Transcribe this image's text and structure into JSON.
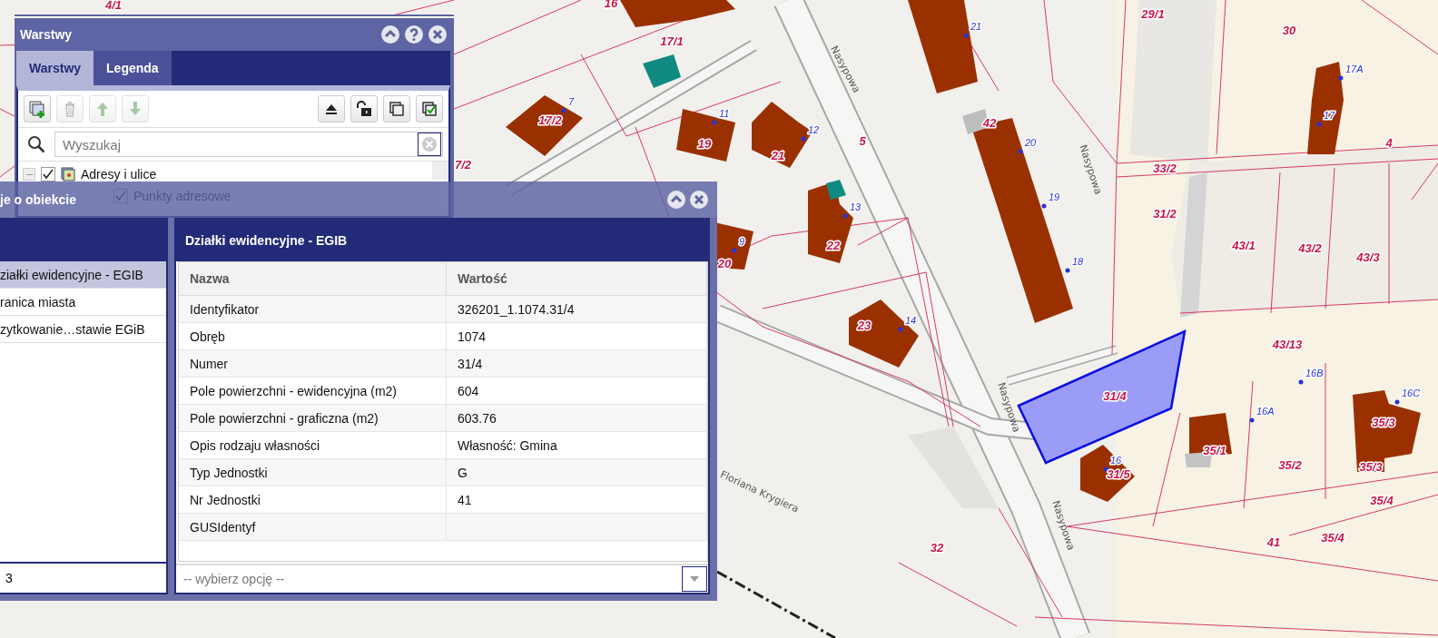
{
  "map": {
    "labels": [
      {
        "kind": "parcel",
        "text": "4/1"
      },
      {
        "kind": "parcel",
        "text": "16"
      },
      {
        "kind": "parcel",
        "text": "29/1"
      },
      {
        "kind": "parcel",
        "text": "17/1"
      },
      {
        "kind": "address",
        "text": "21"
      },
      {
        "kind": "parcel",
        "text": "30"
      },
      {
        "kind": "street",
        "text": "Nasypowa"
      },
      {
        "kind": "address",
        "text": "17A"
      },
      {
        "kind": "parcel",
        "text": "17/2"
      },
      {
        "kind": "address",
        "text": "7"
      },
      {
        "kind": "address",
        "text": "11"
      },
      {
        "kind": "parcel",
        "text": "42"
      },
      {
        "kind": "address",
        "text": "17"
      },
      {
        "kind": "parcel",
        "text": "19"
      },
      {
        "kind": "address",
        "text": "12"
      },
      {
        "kind": "parcel",
        "text": "5"
      },
      {
        "kind": "address",
        "text": "20"
      },
      {
        "kind": "parcel",
        "text": "4"
      },
      {
        "kind": "parcel",
        "text": "7/2"
      },
      {
        "kind": "parcel",
        "text": "21"
      },
      {
        "kind": "street",
        "text": "Nasypowa"
      },
      {
        "kind": "parcel",
        "text": "33/2"
      },
      {
        "kind": "address",
        "text": "13"
      },
      {
        "kind": "address",
        "text": "19"
      },
      {
        "kind": "parcel",
        "text": "31/2"
      },
      {
        "kind": "parcel",
        "text": "20"
      },
      {
        "kind": "address",
        "text": "9"
      },
      {
        "kind": "parcel",
        "text": "22"
      },
      {
        "kind": "address",
        "text": "18"
      },
      {
        "kind": "parcel",
        "text": "43/1"
      },
      {
        "kind": "parcel",
        "text": "43/2"
      },
      {
        "kind": "parcel",
        "text": "43/3"
      },
      {
        "kind": "parcel",
        "text": "23"
      },
      {
        "kind": "address",
        "text": "14"
      },
      {
        "kind": "parcel",
        "text": "43/13"
      },
      {
        "kind": "parcel",
        "text": "31/4"
      },
      {
        "kind": "address",
        "text": "16B"
      },
      {
        "kind": "address",
        "text": "16C"
      },
      {
        "kind": "street",
        "text": "Nasypowa"
      },
      {
        "kind": "address",
        "text": "16A"
      },
      {
        "kind": "parcel",
        "text": "35/3"
      },
      {
        "kind": "address",
        "text": "16"
      },
      {
        "kind": "parcel",
        "text": "31/5"
      },
      {
        "kind": "parcel",
        "text": "35/1"
      },
      {
        "kind": "parcel",
        "text": "35/2"
      },
      {
        "kind": "parcel",
        "text": "35/3"
      },
      {
        "kind": "street",
        "text": "Floriana Krygiera"
      },
      {
        "kind": "parcel",
        "text": "35/4"
      },
      {
        "kind": "parcel",
        "text": "32"
      },
      {
        "kind": "street",
        "text": "Nasypowa"
      },
      {
        "kind": "parcel",
        "text": "41"
      },
      {
        "kind": "parcel",
        "text": "35/4"
      }
    ]
  },
  "layers_window": {
    "title": "Warstwy",
    "tabs": [
      {
        "label": "Warstwy",
        "selected": true
      },
      {
        "label": "Legenda",
        "selected": false
      }
    ],
    "toolbar": [
      {
        "kind": "add-layer",
        "disabled": false
      },
      {
        "kind": "delete",
        "disabled": true
      },
      {
        "kind": "move-up",
        "disabled": true
      },
      {
        "kind": "move-down",
        "disabled": true
      },
      {
        "kind": "eject",
        "disabled": false
      },
      {
        "kind": "unlock",
        "disabled": false
      },
      {
        "kind": "copy",
        "disabled": false
      },
      {
        "kind": "check-all",
        "disabled": false
      }
    ],
    "search": {
      "placeholder": "Wyszukaj"
    },
    "tree": [
      {
        "label": "Adresy i ulice",
        "checked": true,
        "expanded": true,
        "children": [
          {
            "label": "Punkty adresowe",
            "checked": true
          }
        ]
      }
    ]
  },
  "info_window": {
    "title": "je o obiekcie",
    "layers": [
      {
        "label": "ziałki ewidencyjne - EGIB",
        "selected": true
      },
      {
        "label": "ranica miasta",
        "selected": false
      },
      {
        "label": "zytkowanie…stawie EGiB",
        "selected": false
      }
    ],
    "count": "3",
    "detail": {
      "title": "Działki ewidencyjne - EGIB",
      "columns": [
        "Nazwa",
        "Wartość"
      ],
      "rows": [
        {
          "name": "Identyfikator",
          "value": "326201_1.1074.31/4"
        },
        {
          "name": "Obręb",
          "value": "1074"
        },
        {
          "name": "Numer",
          "value": "31/4"
        },
        {
          "name": "Pole powierzchni - ewidencyjna (m2)",
          "value": "604"
        },
        {
          "name": "Pole powierzchni - graficzna (m2)",
          "value": "603.76"
        },
        {
          "name": "Opis rodzaju własności",
          "value": "Własność: Gmina"
        },
        {
          "name": "Typ Jednostki",
          "value": "G"
        },
        {
          "name": "Nr Jednostki",
          "value": "41"
        },
        {
          "name": "GUSIdentyf"
        }
      ]
    },
    "select": {
      "placeholder": "-- wybierz opcję --"
    }
  }
}
